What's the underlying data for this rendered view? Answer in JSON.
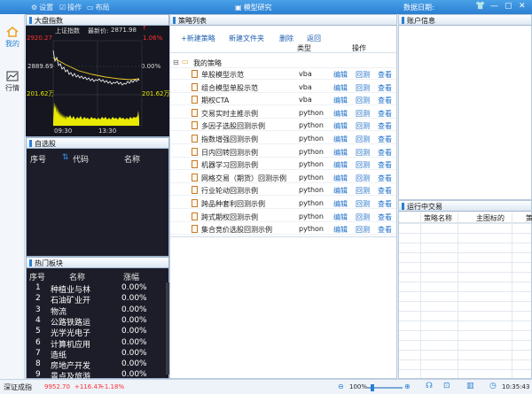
{
  "titlebar": {
    "menu": [
      {
        "icon": "gear-icon",
        "label": "设置"
      },
      {
        "icon": "operate-icon",
        "label": "操作"
      },
      {
        "icon": "layout-icon",
        "label": "布局"
      }
    ],
    "title": "模型研究",
    "date_label": "数据日期:"
  },
  "nav": [
    {
      "icon": "home-icon",
      "label": "我的"
    },
    {
      "icon": "chart-icon",
      "label": "行情"
    }
  ],
  "market": {
    "header": "大盘指数",
    "index_name": "上证指数",
    "latest_label": "最新价:",
    "latest": "2871.98",
    "high": "2920.27",
    "high_pct": "1.06%",
    "base": "2889.69",
    "base_pct": "0.00%",
    "vol_left": "201.62万",
    "vol_right": "201.62万",
    "t_start": "09:30",
    "t_mid": "13:30"
  },
  "watchlist": {
    "header": "自选股",
    "cols": [
      "序号",
      "代码",
      "名称"
    ]
  },
  "hot": {
    "header": "热门板块",
    "cols": [
      "序号",
      "名称",
      "涨幅"
    ],
    "rows": [
      {
        "n": "1",
        "name": "种植业与林",
        "pct": "0.00%"
      },
      {
        "n": "2",
        "name": "石油矿业开",
        "pct": "0.00%"
      },
      {
        "n": "3",
        "name": "物流",
        "pct": "0.00%"
      },
      {
        "n": "4",
        "name": "公路铁路运",
        "pct": "0.00%"
      },
      {
        "n": "5",
        "name": "光学光电子",
        "pct": "0.00%"
      },
      {
        "n": "6",
        "name": "计算机应用",
        "pct": "0.00%"
      },
      {
        "n": "7",
        "name": "造纸",
        "pct": "0.00%"
      },
      {
        "n": "8",
        "name": "房地产开发",
        "pct": "0.00%"
      },
      {
        "n": "9",
        "name": "景点及旅游",
        "pct": "0.00%"
      }
    ]
  },
  "strategy": {
    "header": "策略列表",
    "toolbar": [
      "+新建策略",
      "新建文件夹",
      "删除",
      "返回"
    ],
    "col_type": "类型",
    "col_op": "操作",
    "folder": "我的策略",
    "actions": [
      "编辑",
      "回测",
      "查看"
    ],
    "rows": [
      {
        "name": "单股模型示范",
        "type": "vba"
      },
      {
        "name": "组合模型单股示范",
        "type": "vba"
      },
      {
        "name": "期权CTA",
        "type": "vba"
      },
      {
        "name": "交易实时主推示例",
        "type": "python"
      },
      {
        "name": "多因子选股回测示例",
        "type": "python"
      },
      {
        "name": "指数增强回测示例",
        "type": "python"
      },
      {
        "name": "日内回转回测示例",
        "type": "python"
      },
      {
        "name": "机器学习回测示例",
        "type": "python"
      },
      {
        "name": "网格交易（期货）回测示例",
        "type": "python"
      },
      {
        "name": "行业轮动回测示例",
        "type": "python"
      },
      {
        "name": "跨品种套利回测示例",
        "type": "python"
      },
      {
        "name": "跨式期权回测示例",
        "type": "python"
      },
      {
        "name": "集合竞价选股回测示例",
        "type": "python"
      }
    ]
  },
  "account": {
    "header": "账户信息"
  },
  "running": {
    "header": "运行中交易",
    "cols": [
      "策略名称",
      "主图标的",
      "策"
    ]
  },
  "status": {
    "index_name": "深证成指",
    "value": "9952.70",
    "change": "+116.47",
    "pct": "+1.18%",
    "zoom": "100%",
    "time": "10:35:43"
  },
  "colors": {
    "accent": "#2a7fd2",
    "up": "#ff3030",
    "volume": "#e8e800",
    "price_line": "#ffffff",
    "avg_line": "#f2d02b"
  }
}
